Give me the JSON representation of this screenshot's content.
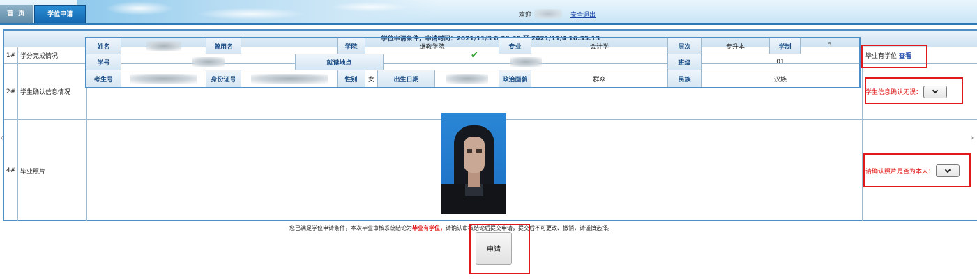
{
  "topbar": {
    "tabs": [
      {
        "label": "首 页",
        "active": false
      },
      {
        "label": "学位申请",
        "active": true
      }
    ],
    "welcome_label": "欢迎",
    "logout_label": "安全退出"
  },
  "header": {
    "title": "学位申请条件，申请时间：2021/11/3 0:08:25 至 2021/11/4 16:35:13"
  },
  "rows": {
    "credits": {
      "num": "1#",
      "label": "学分完成情况",
      "side_text": "毕业有学位",
      "side_link": "查看"
    },
    "student": {
      "num": "2#",
      "label": "学生确认信息情况",
      "side_text": "学生信息确认无误：",
      "select_value": ""
    },
    "photo": {
      "num": "4#",
      "label": "毕业照片",
      "side_text": "请确认照片是否为本人：",
      "select_value": ""
    }
  },
  "info": {
    "name_label": "姓名",
    "former_name_label": "曾用名",
    "college_label": "学院",
    "college_value": "继教学院",
    "major_label": "专业",
    "major_value": "会计学",
    "level_label": "层次",
    "level_value": "专升本",
    "duration_label": "学制",
    "duration_value": "3",
    "student_id_label": "学号",
    "study_place_label": "就读地点",
    "class_label": "班级",
    "class_value": "01",
    "exam_id_label": "考生号",
    "id_card_label": "身份证号",
    "gender_label": "性别",
    "gender_value": "女",
    "birth_label": "出生日期",
    "political_label": "政治面貌",
    "political_value": "群众",
    "ethnic_label": "民族",
    "ethnic_value": "汉族"
  },
  "notice": {
    "prefix": "您已满足学位申请条件，本次毕业审核系统结论为",
    "highlight": "毕业有学位，",
    "suffix": "请确认审核结论后提交申请，提交后不可更改、撤销，请谨慎选择。"
  },
  "apply_button": "申请",
  "colors": {
    "accent": "#2e79b8",
    "annotation_red": "#e01a1a",
    "check_green": "#2ea02e"
  }
}
